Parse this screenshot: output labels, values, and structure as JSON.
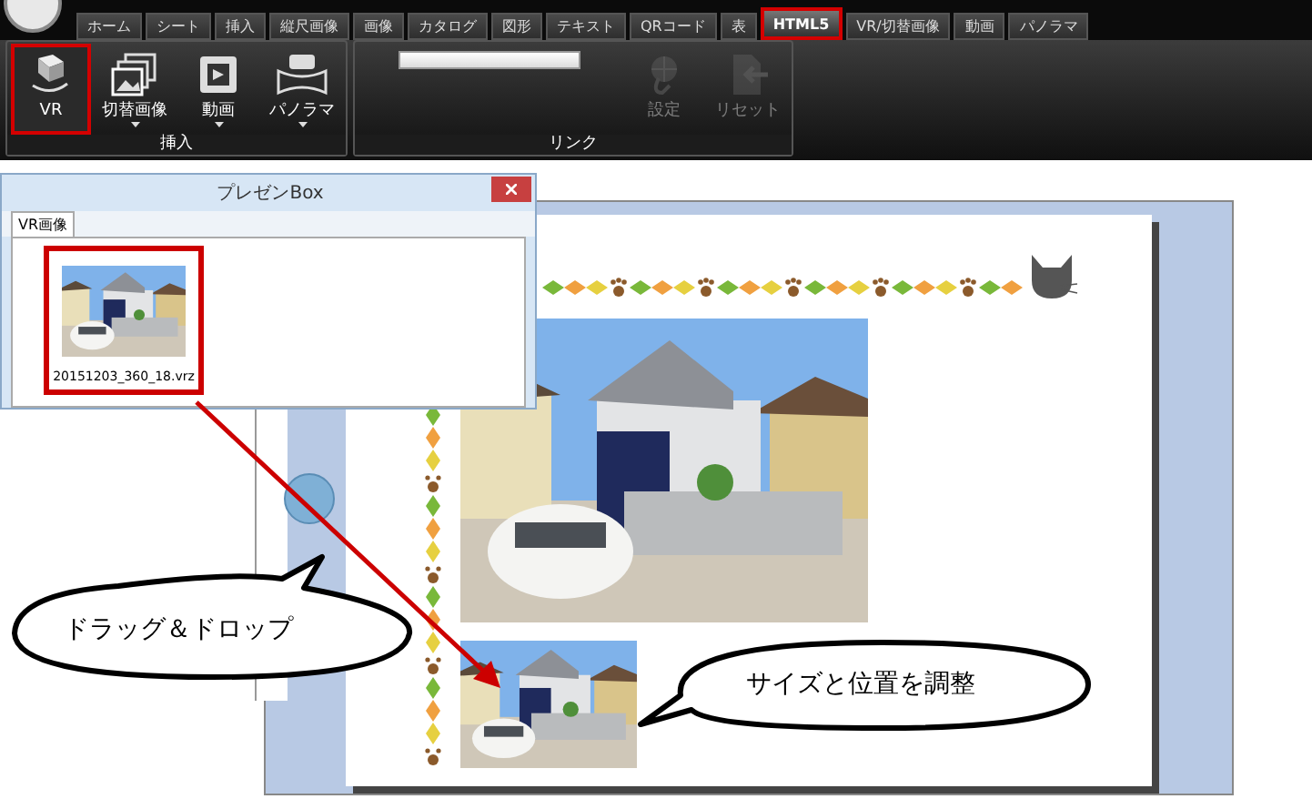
{
  "ribbon": {
    "tabs": [
      {
        "label": "ホーム",
        "selected": false
      },
      {
        "label": "シート",
        "selected": false
      },
      {
        "label": "挿入",
        "selected": false
      },
      {
        "label": "縦尺画像",
        "selected": false
      },
      {
        "label": "画像",
        "selected": false
      },
      {
        "label": "カタログ",
        "selected": false
      },
      {
        "label": "図形",
        "selected": false
      },
      {
        "label": "テキスト",
        "selected": false
      },
      {
        "label": "QRコード",
        "selected": false
      },
      {
        "label": "表",
        "selected": false
      },
      {
        "label": "HTML5",
        "selected": true
      },
      {
        "label": "VR/切替画像",
        "selected": false
      },
      {
        "label": "動画",
        "selected": false
      },
      {
        "label": "パノラマ",
        "selected": false
      }
    ],
    "groups": [
      {
        "label": "挿入",
        "buttons": [
          {
            "label": "VR",
            "selected": true,
            "disabled": false,
            "dropdown": false
          },
          {
            "label": "切替画像",
            "selected": false,
            "disabled": false,
            "dropdown": true
          },
          {
            "label": "動画",
            "selected": false,
            "disabled": false,
            "dropdown": true
          },
          {
            "label": "パノラマ",
            "selected": false,
            "disabled": false,
            "dropdown": true
          }
        ]
      },
      {
        "label": "リンク",
        "buttons": [
          {
            "label": "設定",
            "selected": false,
            "disabled": true,
            "dropdown": false
          },
          {
            "label": "リセット",
            "selected": false,
            "disabled": true,
            "dropdown": false
          }
        ]
      }
    ]
  },
  "presen_box": {
    "title": "プレゼンBox",
    "tabs": [
      {
        "label": "VR画像",
        "selected": true
      }
    ],
    "files": [
      {
        "name": "20151203_360_18.vrz",
        "selected": true
      }
    ]
  },
  "callouts": [
    {
      "text": "ドラッグ＆ドロップ"
    },
    {
      "text": "サイズと位置を調整"
    }
  ]
}
